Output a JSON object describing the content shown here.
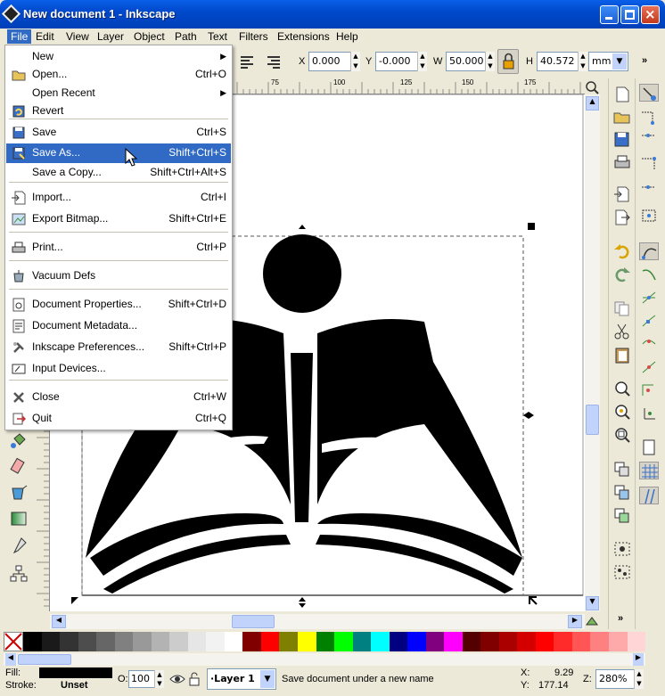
{
  "window": {
    "title": "New document 1 - Inkscape"
  },
  "menubar": [
    "File",
    "Edit",
    "View",
    "Layer",
    "Object",
    "Path",
    "Text",
    "Filters",
    "Extensions",
    "Help"
  ],
  "toolbar": {
    "x_label": "X",
    "x_value": "0.000",
    "y_label": "Y",
    "y_value": "-0.000",
    "w_label": "W",
    "w_value": "50.000",
    "h_label": "H",
    "h_value": "40.572",
    "unit": "mm"
  },
  "ruler": {
    "h_ticks": [
      "75",
      "100",
      "125",
      "150",
      "175"
    ]
  },
  "file_menu": {
    "items": [
      {
        "label": "New",
        "shortcut": "",
        "submenu": true,
        "icon": "none"
      },
      {
        "label": "Open...",
        "shortcut": "Ctrl+O",
        "icon": "folder-icon"
      },
      {
        "label": "Open Recent",
        "shortcut": "",
        "submenu": true,
        "icon": "none"
      },
      {
        "label": "Revert",
        "shortcut": "",
        "icon": "revert-icon"
      },
      {
        "label": "Save",
        "shortcut": "Ctrl+S",
        "icon": "save-icon"
      },
      {
        "label": "Save As...",
        "shortcut": "Shift+Ctrl+S",
        "icon": "save-as-icon",
        "highlighted": true
      },
      {
        "label": "Save a Copy...",
        "shortcut": "Shift+Ctrl+Alt+S",
        "icon": "none"
      },
      {
        "label": "Import...",
        "shortcut": "Ctrl+I",
        "icon": "import-icon"
      },
      {
        "label": "Export Bitmap...",
        "shortcut": "Shift+Ctrl+E",
        "icon": "export-icon"
      },
      {
        "label": "Print...",
        "shortcut": "Ctrl+P",
        "icon": "printer-icon"
      },
      {
        "label": "Vacuum Defs",
        "shortcut": "",
        "icon": "vacuum-icon"
      },
      {
        "label": "Document Properties...",
        "shortcut": "Shift+Ctrl+D",
        "icon": "document-properties-icon"
      },
      {
        "label": "Document Metadata...",
        "shortcut": "",
        "icon": "metadata-icon"
      },
      {
        "label": "Inkscape Preferences...",
        "shortcut": "Shift+Ctrl+P",
        "icon": "preferences-icon"
      },
      {
        "label": "Input Devices...",
        "shortcut": "",
        "icon": "input-devices-icon"
      },
      {
        "label": "Close",
        "shortcut": "Ctrl+W",
        "icon": "close-doc-icon"
      },
      {
        "label": "Quit",
        "shortcut": "Ctrl+Q",
        "icon": "quit-icon"
      }
    ]
  },
  "palette": [
    "#000000",
    "#1a1a1a",
    "#333333",
    "#4d4d4d",
    "#666666",
    "#808080",
    "#999999",
    "#b3b3b3",
    "#cccccc",
    "#e6e6e6",
    "#f2f2f2",
    "#ffffff",
    "#800000",
    "#ff0000",
    "#808000",
    "#ffff00",
    "#008000",
    "#00ff00",
    "#008080",
    "#00ffff",
    "#000080",
    "#0000ff",
    "#800080",
    "#ff00ff",
    "#550000",
    "#800000",
    "#aa0000",
    "#d40000",
    "#ff0000",
    "#ff2a2a",
    "#ff5555",
    "#ff8080",
    "#ffaaaa",
    "#ffd5d5"
  ],
  "status": {
    "fill_label": "Fill:",
    "stroke_label": "Stroke:",
    "stroke_value": "Unset",
    "opacity_label": "O:",
    "opacity_value": "100",
    "layer": "·Layer 1",
    "message": "Save document under a new name",
    "x_label": "X:",
    "x_value": "9.29",
    "y_label": "Y:",
    "y_value": "177.14",
    "zoom_label": "Z:",
    "zoom_value": "280%"
  }
}
